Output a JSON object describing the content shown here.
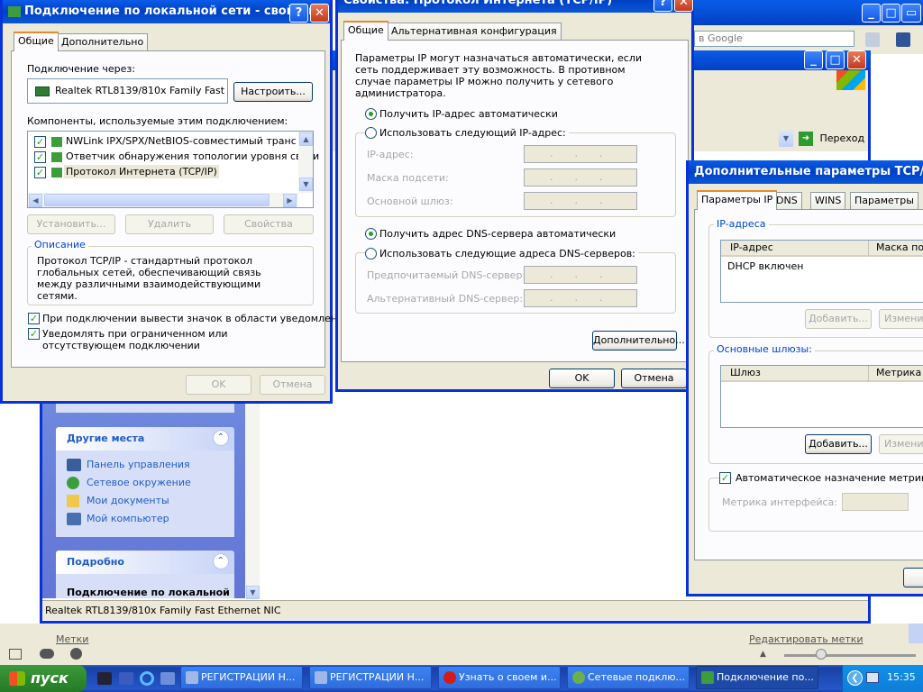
{
  "browser": {
    "search_placeholder": "в Google",
    "go_label": "Переход"
  },
  "explorer": {
    "other_places_title": "Другие места",
    "other_places": [
      "Панель управления",
      "Сетевое окружение",
      "Мои документы",
      "Мой компьютер"
    ],
    "details_title": "Подробно",
    "details_name": "Подключение по локальной",
    "status_text": "Realtek RTL8139/810x Family Fast Ethernet NIC"
  },
  "lan_props": {
    "title": "Подключение по локальной сети - свойства",
    "tabs": [
      "Общие",
      "Дополнительно"
    ],
    "connect_using_label": "Подключение через:",
    "adapter": "Realtek RTL8139/810x Family Fast",
    "configure_btn": "Настроить...",
    "components_label": "Компоненты, используемые этим подключением:",
    "components": [
      "NWLink IPX/SPX/NetBIOS-совместимый транспорт",
      "Ответчик обнаружения топологии уровня связи",
      "Протокол Интернета (TCP/IP)"
    ],
    "install_btn": "Установить...",
    "uninstall_btn": "Удалить",
    "properties_btn": "Свойства",
    "description_label": "Описание",
    "description_text": "Протокол TCP/IP - стандартный протокол глобальных сетей, обеспечивающий связь между различными взаимодействующими сетями.",
    "show_icon_label": "При подключении вывести значок в области уведомлений",
    "notify_label": "Уведомлять при ограниченном или отсутствующем подключении",
    "ok_btn": "OK",
    "cancel_btn": "Отмена"
  },
  "tcpip": {
    "title": "Свойства: Протокол Интернета (TCP/IP)",
    "tabs": [
      "Общие",
      "Альтернативная конфигурация"
    ],
    "intro": "Параметры IP могут назначаться автоматически, если сеть поддерживает эту возможность. В противном случае параметры IP можно получить у сетевого администратора.",
    "auto_ip": "Получить IP-адрес автоматически",
    "manual_ip": "Использовать следующий IP-адрес:",
    "ip_label": "IP-адрес:",
    "mask_label": "Маска подсети:",
    "gateway_label": "Основной шлюз:",
    "auto_dns": "Получить адрес DNS-сервера автоматически",
    "manual_dns": "Использовать следующие адреса DNS-серверов:",
    "pref_dns_label": "Предпочитаемый DNS-сервер:",
    "alt_dns_label": "Альтернативный DNS-сервер:",
    "advanced_btn": "Дополнительно...",
    "ok_btn": "OK",
    "cancel_btn": "Отмена"
  },
  "advanced": {
    "title": "Дополнительные параметры TCP/IP",
    "tabs": [
      "Параметры IP",
      "DNS",
      "WINS",
      "Параметры"
    ],
    "ip_group": "IP-адреса",
    "ip_col": "IP-адрес",
    "mask_col": "Маска под",
    "dhcp_row": "DHCP включен",
    "add_btn": "Добавить...",
    "edit_btn": "Изменит",
    "gw_group": "Основные шлюзы:",
    "gw_col": "Шлюз",
    "metric_col": "Метрика",
    "auto_metric": "Автоматическое назначение метрики",
    "iface_metric": "Метрика интерфейса:"
  },
  "bottom": {
    "labels_left": "Метки",
    "labels_right": "Редактировать метки"
  },
  "taskbar": {
    "start": "пуск",
    "tasks": [
      "РЕГИСТРАЦИИ Н...",
      "РЕГИСТРАЦИИ Н...",
      "Узнать о своем и...",
      "Сетевые подклю...",
      "Подключение по..."
    ],
    "clock": "15:35"
  }
}
